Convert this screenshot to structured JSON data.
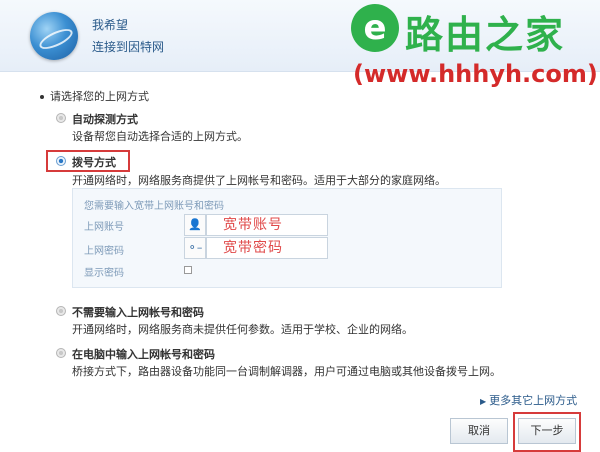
{
  "header": {
    "title": "我希望",
    "subtitle": "连接到因特网",
    "icon": "globe-icon"
  },
  "watermark": {
    "logo_glyph": "e",
    "name": "路由之家",
    "url": "(www.hhhyh.com)",
    "color": "#2fb14c",
    "url_color": "#d42a2a"
  },
  "prompt": "请选择您的上网方式",
  "options": [
    {
      "title": "自动探测方式",
      "desc": "设备帮您自动选择合适的上网方式。",
      "selected": false
    },
    {
      "title": "拨号方式",
      "desc": "开通网络时，网络服务商提供了上网帐号和密码。适用于大部分的家庭网络。",
      "selected": true
    },
    {
      "title": "不需要输入上网帐号和密码",
      "desc": "开通网络时，网络服务商未提供任何参数。适用于学校、企业的网络。",
      "selected": false
    },
    {
      "title": "在电脑中输入上网帐号和密码",
      "desc": "桥接方式下，路由器设备功能同一台调制解调器，用户可通过电脑或其他设备拨号上网。",
      "selected": false
    }
  ],
  "dialup_panel": {
    "hint": "您需要输入宽带上网账号和密码",
    "account_label": "上网账号",
    "account_value": "宽带账号",
    "password_label": "上网密码",
    "password_value": "宽带密码",
    "show_password_label": "显示密码"
  },
  "more_link": "更多其它上网方式",
  "buttons": {
    "cancel": "取消",
    "next": "下一步"
  },
  "colors": {
    "highlight": "#d63b3b",
    "accent": "#2a78c6"
  }
}
